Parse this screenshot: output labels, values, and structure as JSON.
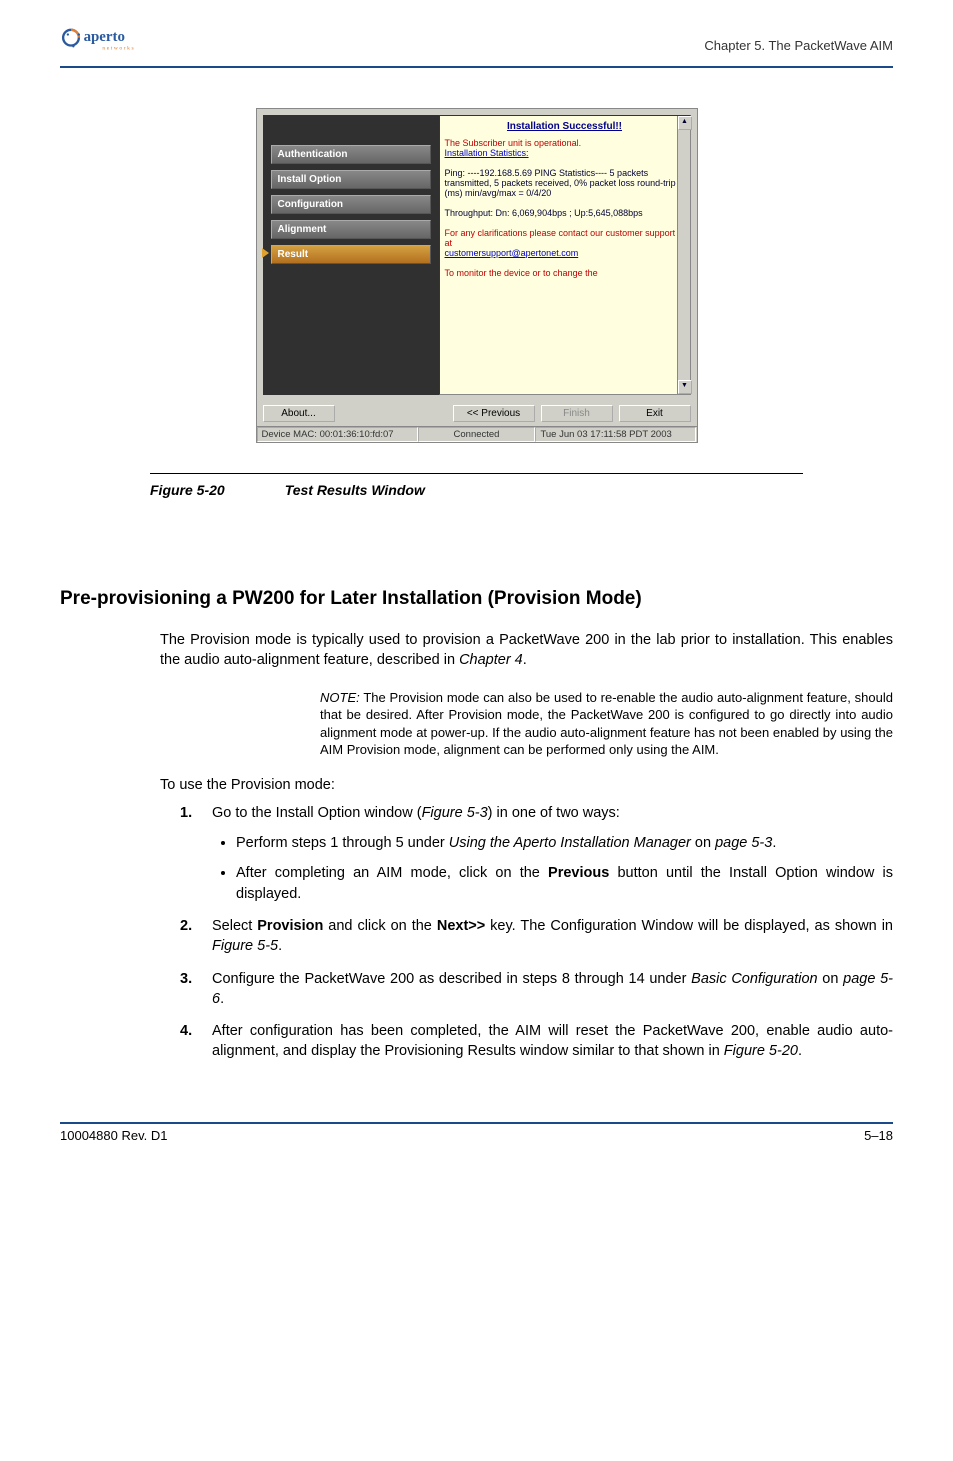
{
  "header": {
    "logo_text_main": "aperto",
    "logo_text_sub": "networks",
    "chapter_label": "Chapter 5.  The PacketWave AIM"
  },
  "window": {
    "nav": {
      "auth": "Authentication",
      "install": "Install Option",
      "config": "Configuration",
      "align": "Alignment",
      "result": "Result"
    },
    "result_panel": {
      "title": "Installation Successful!!",
      "line1": "The Subscriber unit is operational.",
      "line2": "Installation Statistics:",
      "ping": "Ping: ----192.168.5.69 PING Statistics---- 5 packets transmitted, 5 packets received, 0% packet loss round-trip (ms) min/avg/max = 0/4/20",
      "throughput": "Throughput: Dn: 6,069,904bps ; Up:5,645,088bps",
      "support1": "For any clarifications please contact our customer support at",
      "support_link": "customersupport@apertonet.com",
      "monitor": "To monitor the device or to change the"
    },
    "buttons": {
      "about": "About...",
      "previous": "<< Previous",
      "finish": "Finish",
      "exit": "Exit"
    },
    "status": {
      "mac": "Device MAC: 00:01:36:10:fd:07",
      "conn": "Connected",
      "date": "Tue Jun 03 17:11:58 PDT 2003"
    }
  },
  "figure": {
    "number": "Figure 5-20",
    "title": "Test Results Window"
  },
  "section": {
    "heading": "Pre-provisioning a PW200 for Later Installation (Provision Mode)",
    "para1_a": "The Provision mode is typically used to provision a PacketWave 200 in the lab prior to installation. This enables the audio auto-alignment feature, described in ",
    "para1_ref": "Chapter 4",
    "para1_b": ".",
    "note_label": "NOTE:",
    "note_body": "  The Provision mode can also be used to re-enable the audio auto-alignment feature, should that be desired. After Provision mode, the PacketWave 200 is configured to go directly into audio alignment mode at power-up. If the audio auto-alignment feature has not been enabled by using the AIM Provision mode, alignment can be performed only using the AIM.",
    "intro": "To use the Provision mode:",
    "steps": {
      "s1_a": "Go to the Install Option window (",
      "s1_ref": "Figure 5-3",
      "s1_b": ") in one of two ways:",
      "s1_bullet1_a": "Perform steps 1 through 5 under ",
      "s1_bullet1_ref": "Using the Aperto Installation Manager",
      "s1_bullet1_b": " on ",
      "s1_bullet1_ref2": "page 5-3",
      "s1_bullet1_c": ".",
      "s1_bullet2_a": "After completing an AIM mode, click on the ",
      "s1_bullet2_bold": "Previous",
      "s1_bullet2_b": " button until the Install Option window is displayed.",
      "s2_a": "Select ",
      "s2_bold1": "Provision",
      "s2_b": " and click on the ",
      "s2_bold2": "Next>>",
      "s2_c": " key. The Configuration Window will be displayed, as shown in ",
      "s2_ref": "Figure 5-5",
      "s2_d": ".",
      "s3_a": "Configure the PacketWave 200 as described in steps 8 through 14 under ",
      "s3_ref1": "Basic Configuration",
      "s3_b": " on ",
      "s3_ref2": "page 5-6",
      "s3_c": ".",
      "s4_a": "After configuration has been completed, the AIM will reset the PacketWave 200, enable audio auto-alignment, and display the Provisioning Results window similar to that shown in ",
      "s4_ref": "Figure 5-20",
      "s4_b": "."
    }
  },
  "footer": {
    "left": "10004880 Rev. D1",
    "right": "5–18"
  }
}
